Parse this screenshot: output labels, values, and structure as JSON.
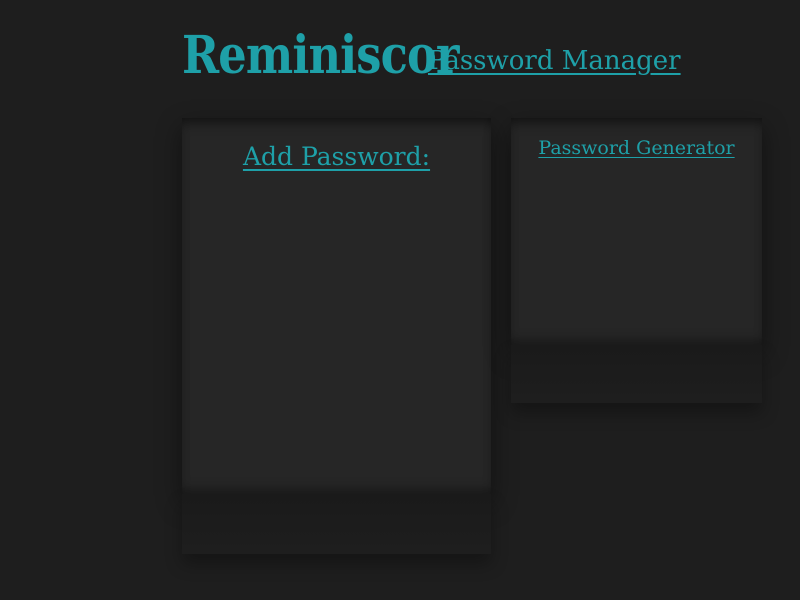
{
  "header": {
    "logo_text": "Reminiscor",
    "title": "Password Manager"
  },
  "panels": {
    "add_password": {
      "heading": "Add Password:"
    },
    "password_generator": {
      "heading": "Password Generator"
    }
  },
  "colors": {
    "background": "#1e1e1e",
    "panel": "#262626",
    "accent": "#1ea0a8"
  }
}
